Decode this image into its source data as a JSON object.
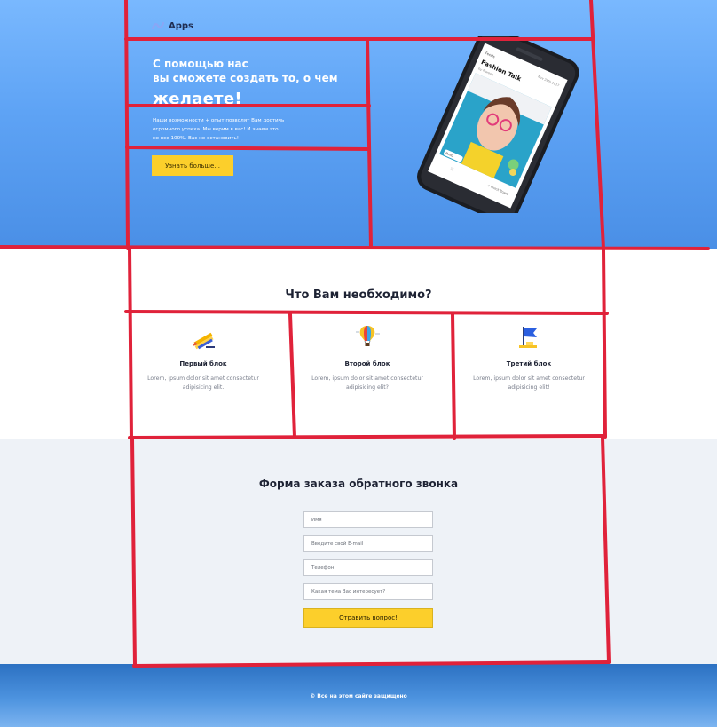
{
  "header": {
    "logo_text": "Apps"
  },
  "hero": {
    "title_line1": "С помощью нас",
    "title_line2": "вы сможете создать то, о чем",
    "title_big": "желаете!",
    "description": "Наши возможности + опыт позволят Вам достичь огромного успеха. Мы верим в вас! И знаем это не все 100%. Вас не остановить!",
    "cta_label": "Узнать больше..."
  },
  "phone_screen": {
    "back_label": "Feeds",
    "title": "Fashion Talk",
    "subtitle": "by Mareen",
    "date_label": "Nov 28th 2017",
    "bottom_left": "Hello",
    "bottom_right": "+ Quick Board"
  },
  "needs": {
    "title": "Что Вам необходимо?",
    "features": [
      {
        "icon": "pencil-icon",
        "title": "Первый блок",
        "text": "Lorem, ipsum dolor sit amet consectetur adipisicing elit."
      },
      {
        "icon": "hot-air-balloon-icon",
        "title": "Второй блок",
        "text": "Lorem, ipsum dolor sit amet consectetur adipisicing elit?"
      },
      {
        "icon": "flag-icon",
        "title": "Третий блок",
        "text": "Lorem, ipsum dolor sit amet consectetur adipisicing elit!"
      }
    ]
  },
  "form": {
    "title": "Форма заказа обратного звонка",
    "name_placeholder": "Имя",
    "email_placeholder": "Введите свой E-mail",
    "phone_placeholder": "Телефон",
    "topic_placeholder": "Какая тема Вас интересует?",
    "submit_label": "Отравить вопрос!"
  },
  "footer": {
    "text": "© Все на этом сайте защищено"
  },
  "colors": {
    "hero_gradient_top": "#79b8fe",
    "hero_gradient_bottom": "#4a8fe6",
    "accent_yellow": "#fccf2b",
    "guide_red": "#e0223a",
    "form_bg": "#eef2f7"
  }
}
